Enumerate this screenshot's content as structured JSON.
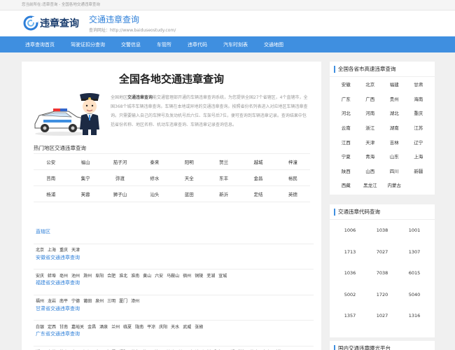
{
  "topbar": {
    "text": "您当前所在:违章查询 - 全国各地交通违章查询"
  },
  "header": {
    "logo_text": "违章查询",
    "site_title": "交通违章查询",
    "site_url": "查询网址：http://www.baiduseostudy.com/"
  },
  "nav": [
    "违章查询首页",
    "驾驶证扣分查询",
    "交警信息",
    "车管所",
    "违章代码",
    "汽车时刻表",
    "交通地图"
  ],
  "main": {
    "title": "全国各地交通违章查询",
    "intro_prefix": "全国地区",
    "intro_bold": "交通违章查询",
    "intro_rest": "能交通管理部开通的车辆违章查询系统，为您提供全国27个省辖区，4个直辖市，全国368个城市车辆违章查询。车辆在本地或异地的交通违章查询。按照省份名列表进入对应地区车辆违章查询。只需要输入自己的车牌号及发动机号后六位、车架号后7位，便可查询到车辆违章记录。查询结果中包括省份名称、地区名称、机动车违章查询、车辆违章记录查询信息。",
    "hot_title": "热门地区交通违章查询",
    "hot_cities": [
      "公安",
      "福山",
      "茄子河",
      "泰来",
      "阳明",
      "贺兰",
      "越城",
      "梓潼",
      "莒南",
      "集宁",
      "弥渡",
      "修水",
      "天全",
      "东丰",
      "金昌",
      "裕民",
      "杨浦",
      "芙蓉",
      "狮子山",
      "汕头",
      "蓝田",
      "新沂",
      "定结",
      "英德"
    ],
    "regions": [
      {
        "name": "直辖区",
        "cities": [
          "北京",
          "上海",
          "重庆",
          "天津"
        ]
      },
      {
        "name": "安徽省交通违章查询",
        "cities": [
          "安庆",
          "蚌埠",
          "亳州",
          "池州",
          "滁州",
          "阜阳",
          "合肥",
          "淮北",
          "淮南",
          "黄山",
          "六安",
          "马鞍山",
          "宿州",
          "铜陵",
          "芜湖",
          "宣城"
        ]
      },
      {
        "name": "福建省交通违章查询",
        "cities": [
          "福州",
          "龙岩",
          "南平",
          "宁德",
          "莆田",
          "泉州",
          "三明",
          "厦门",
          "漳州"
        ]
      },
      {
        "name": "甘肃省交通违章查询",
        "cities": [
          "白银",
          "定西",
          "甘南",
          "嘉峪关",
          "金昌",
          "酒泉",
          "兰州",
          "临夏",
          "陇南",
          "平凉",
          "庆阳",
          "天水",
          "武威",
          "张掖"
        ]
      },
      {
        "name": "广东省交通违章查询",
        "cities": [
          "潮州",
          "东莞",
          "佛山",
          "广州",
          "河源",
          "惠州",
          "江门",
          "揭阳",
          "茂名",
          "梅州",
          "清远",
          "汕头",
          "汕尾",
          "韶关",
          "深圳",
          "阳江",
          "云浮",
          "湛江",
          "肇庆",
          "中山",
          "珠海"
        ]
      }
    ]
  },
  "side_provinces": {
    "title": "全国各省市高速违章查询",
    "items": [
      "安徽",
      "北京",
      "福建",
      "甘肃",
      "广东",
      "广西",
      "贵州",
      "海南",
      "河北",
      "河南",
      "湖北",
      "重庆",
      "云南",
      "浙江",
      "湖南",
      "江苏",
      "江西",
      "天津",
      "吉林",
      "辽宁",
      "宁夏",
      "青海",
      "山东",
      "上海",
      "陕西",
      "山西",
      "四川",
      "新疆",
      "西藏",
      "黑龙江",
      "内蒙古"
    ]
  },
  "side_codes": {
    "title": "交通违章代码查询",
    "items": [
      "1006",
      "1038",
      "1001",
      "1713",
      "7027",
      "1307",
      "1036",
      "7038",
      "6015",
      "5002",
      "1720",
      "5040",
      "1357",
      "1027",
      "1316"
    ]
  },
  "side_third": {
    "title": "国内交通违章曝光平台"
  },
  "colors": {
    "nav": "#3f8fe0",
    "accent": "#2e7fd8",
    "bg": "#f0f0f0"
  }
}
